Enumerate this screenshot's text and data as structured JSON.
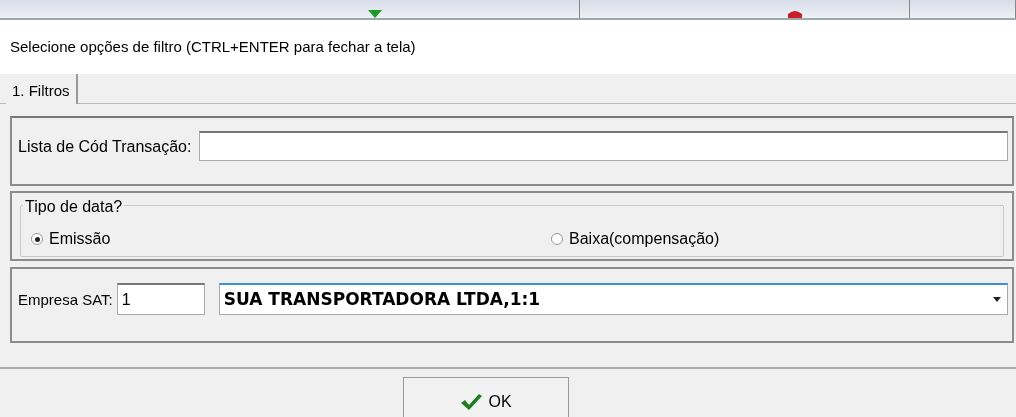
{
  "window": {
    "title": "Selecione opções de filtro (CTRL+ENTER para fechar a tela)"
  },
  "tabs": [
    {
      "label": "1. Filtros"
    }
  ],
  "transaction_list": {
    "label": "Lista de Cód Transação:"
  },
  "date_type": {
    "legend": "Tipo de data?",
    "options": [
      {
        "label": "Emissão",
        "selected": true
      },
      {
        "label": "Baixa(compensação)",
        "selected": false
      }
    ]
  },
  "company": {
    "label": "Empresa SAT:",
    "code": "1",
    "selection": "SUA TRANSPORTADORA LTDA,1:1"
  },
  "buttons": [
    {
      "label": "OK"
    }
  ]
}
